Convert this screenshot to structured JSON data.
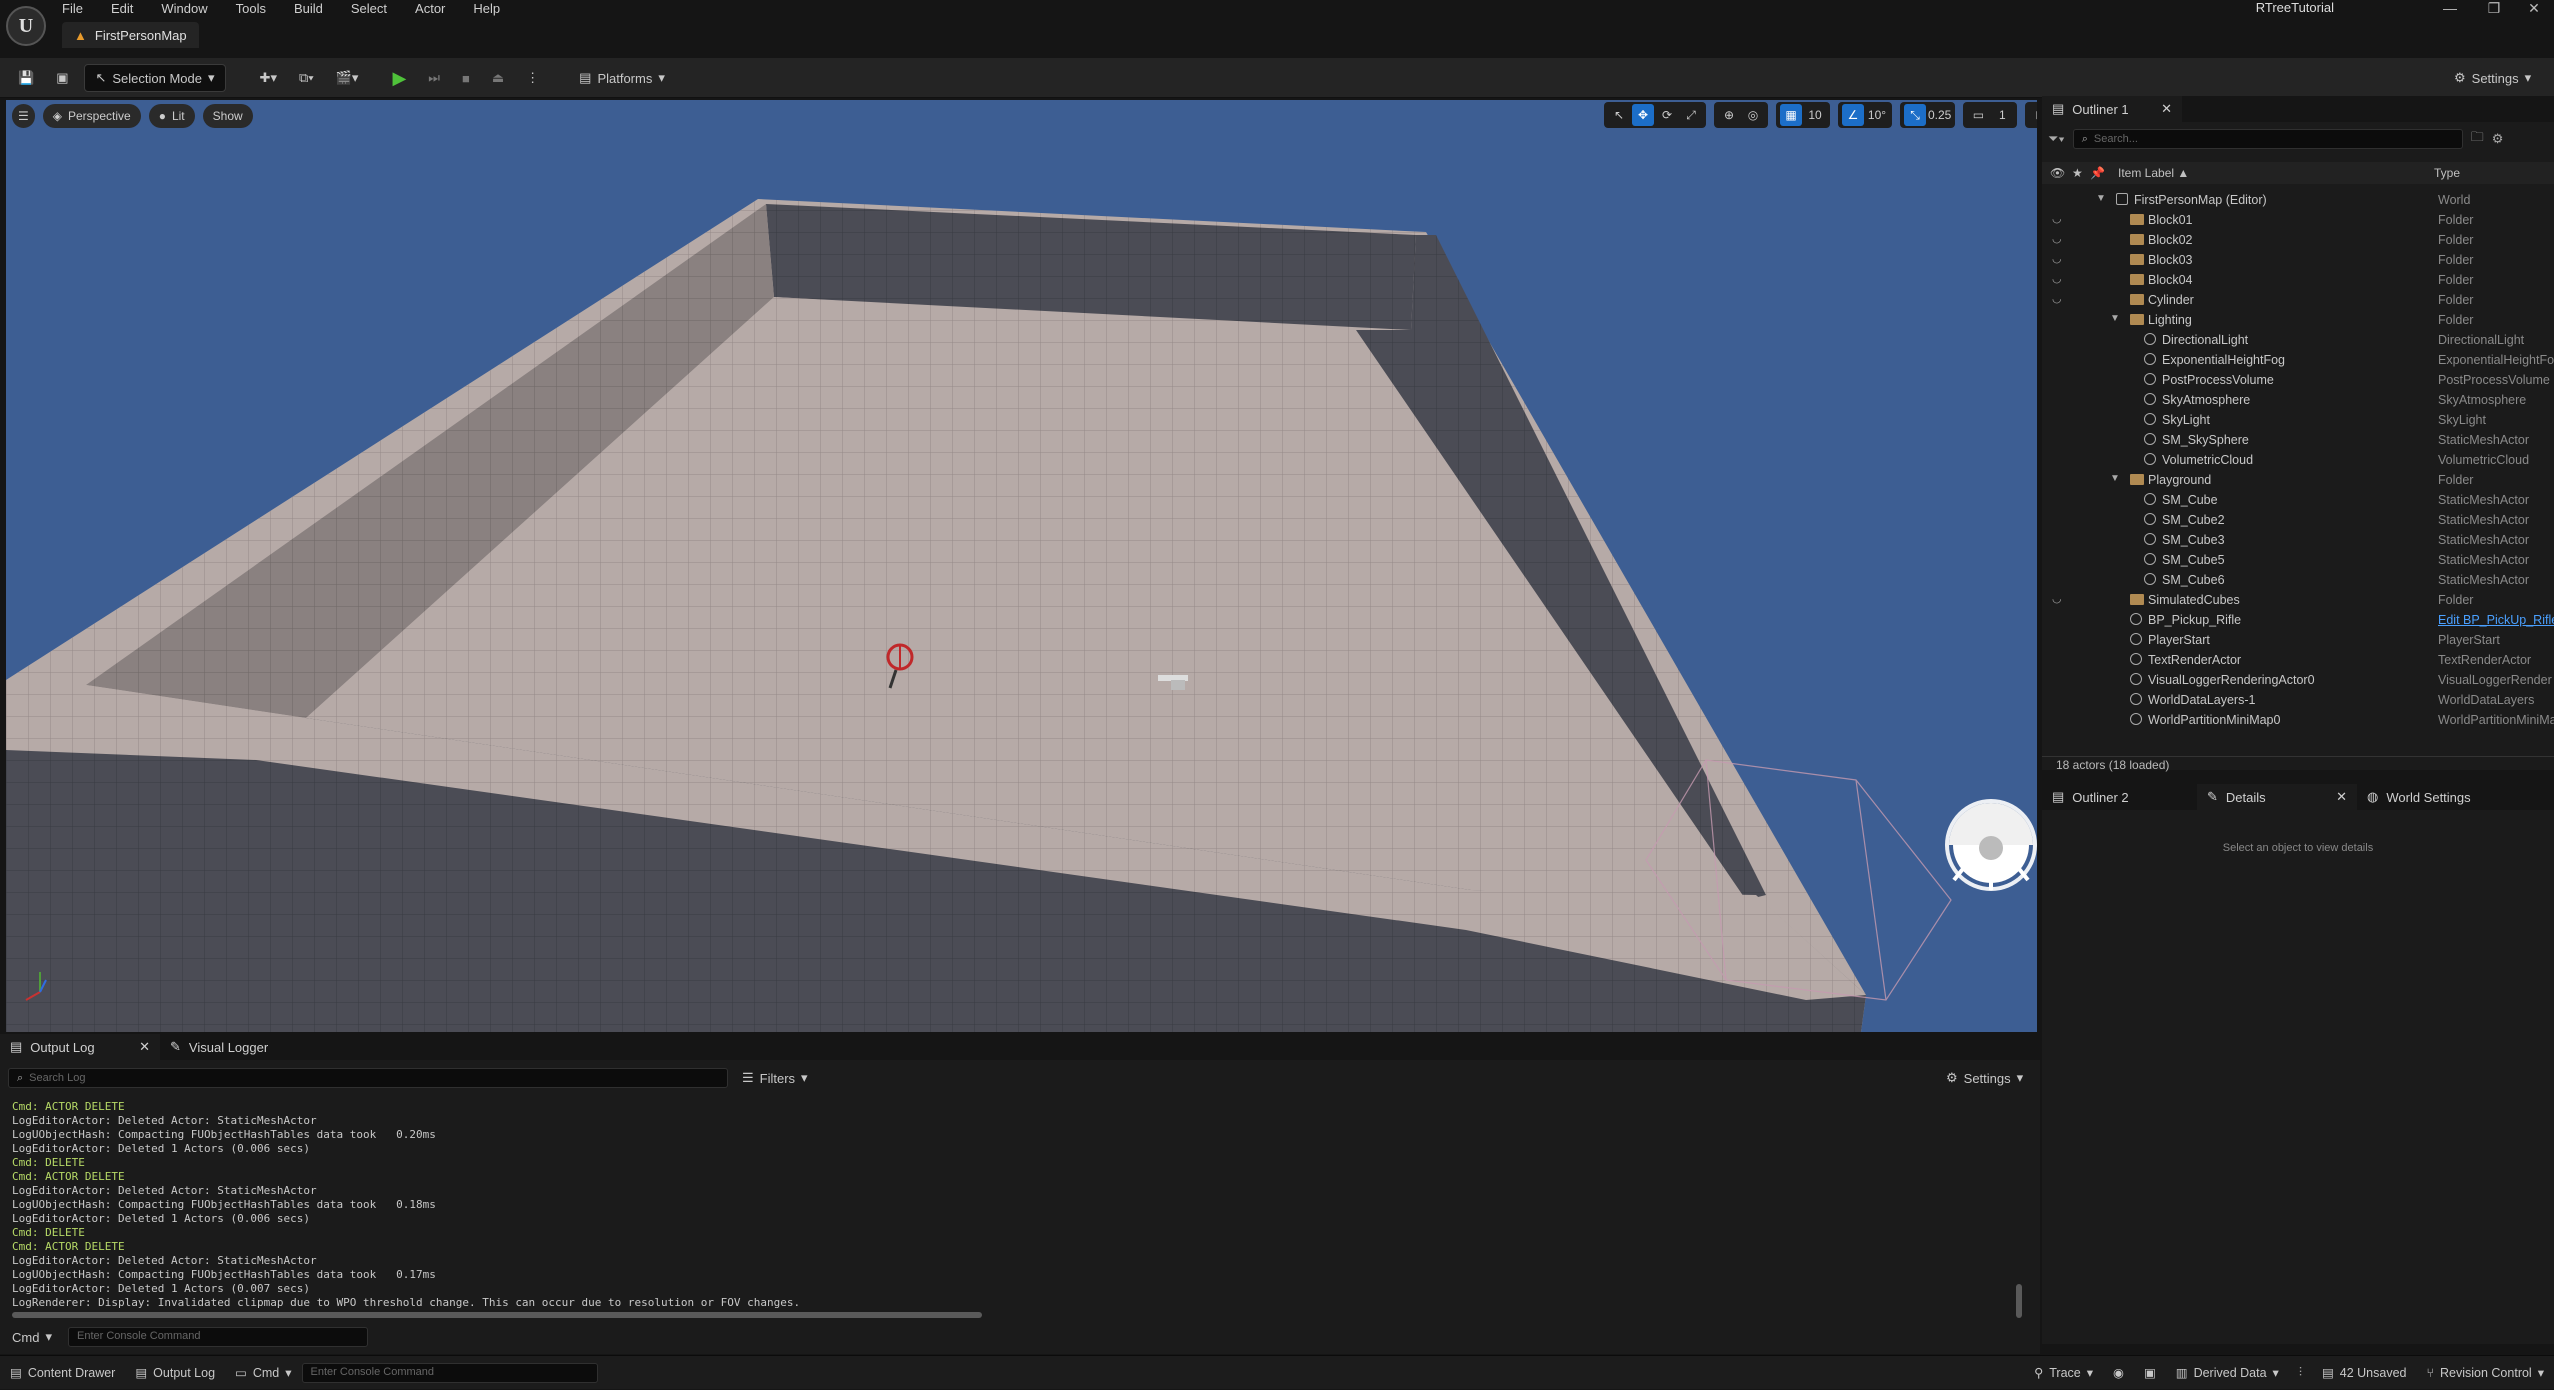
{
  "menu": [
    "File",
    "Edit",
    "Window",
    "Tools",
    "Build",
    "Select",
    "Actor",
    "Help"
  ],
  "map_tab": "FirstPersonMap",
  "app_title": "RTreeTutorial",
  "toolbar": {
    "selection_mode": "Selection Mode",
    "platforms": "Platforms",
    "settings": "Settings"
  },
  "viewport": {
    "perspective": "Perspective",
    "lit": "Lit",
    "show": "Show",
    "grid_snap": "10",
    "rot_snap": "10°",
    "scale_snap": "0.25",
    "camera_speed": "1"
  },
  "outliner": {
    "tab": "Outliner 1",
    "search_placeholder": "Search...",
    "col_label": "Item Label ▲",
    "col_type": "Type",
    "items": [
      {
        "label": "FirstPersonMap (Editor)",
        "type": "World",
        "indent": 0,
        "kind": "world",
        "caret": "▼"
      },
      {
        "label": "Block01",
        "type": "Folder",
        "indent": 1,
        "kind": "folder",
        "eye": "◡"
      },
      {
        "label": "Block02",
        "type": "Folder",
        "indent": 1,
        "kind": "folder",
        "eye": "◡"
      },
      {
        "label": "Block03",
        "type": "Folder",
        "indent": 1,
        "kind": "folder",
        "eye": "◡"
      },
      {
        "label": "Block04",
        "type": "Folder",
        "indent": 1,
        "kind": "folder",
        "eye": "◡"
      },
      {
        "label": "Cylinder",
        "type": "Folder",
        "indent": 1,
        "kind": "folder",
        "eye": "◡"
      },
      {
        "label": "Lighting",
        "type": "Folder",
        "indent": 1,
        "kind": "folder",
        "caret": "▼"
      },
      {
        "label": "DirectionalLight",
        "type": "DirectionalLight",
        "indent": 2,
        "kind": "actor"
      },
      {
        "label": "ExponentialHeightFog",
        "type": "ExponentialHeightFog",
        "indent": 2,
        "kind": "actor"
      },
      {
        "label": "PostProcessVolume",
        "type": "PostProcessVolume",
        "indent": 2,
        "kind": "actor"
      },
      {
        "label": "SkyAtmosphere",
        "type": "SkyAtmosphere",
        "indent": 2,
        "kind": "actor"
      },
      {
        "label": "SkyLight",
        "type": "SkyLight",
        "indent": 2,
        "kind": "actor"
      },
      {
        "label": "SM_SkySphere",
        "type": "StaticMeshActor",
        "indent": 2,
        "kind": "actor"
      },
      {
        "label": "VolumetricCloud",
        "type": "VolumetricCloud",
        "indent": 2,
        "kind": "actor"
      },
      {
        "label": "Playground",
        "type": "Folder",
        "indent": 1,
        "kind": "folder",
        "caret": "▼"
      },
      {
        "label": "SM_Cube",
        "type": "StaticMeshActor",
        "indent": 2,
        "kind": "actor"
      },
      {
        "label": "SM_Cube2",
        "type": "StaticMeshActor",
        "indent": 2,
        "kind": "actor"
      },
      {
        "label": "SM_Cube3",
        "type": "StaticMeshActor",
        "indent": 2,
        "kind": "actor"
      },
      {
        "label": "SM_Cube5",
        "type": "StaticMeshActor",
        "indent": 2,
        "kind": "actor"
      },
      {
        "label": "SM_Cube6",
        "type": "StaticMeshActor",
        "indent": 2,
        "kind": "actor"
      },
      {
        "label": "SimulatedCubes",
        "type": "Folder",
        "indent": 1,
        "kind": "folder",
        "eye": "◡"
      },
      {
        "label": "BP_Pickup_Rifle",
        "type": "Edit BP_PickUp_Rifle",
        "indent": 1,
        "kind": "actor",
        "link": true
      },
      {
        "label": "PlayerStart",
        "type": "PlayerStart",
        "indent": 1,
        "kind": "actor"
      },
      {
        "label": "TextRenderActor",
        "type": "TextRenderActor",
        "indent": 1,
        "kind": "actor"
      },
      {
        "label": "VisualLoggerRenderingActor0",
        "type": "VisualLoggerRender",
        "indent": 1,
        "kind": "actor"
      },
      {
        "label": "WorldDataLayers-1",
        "type": "WorldDataLayers",
        "indent": 1,
        "kind": "actor"
      },
      {
        "label": "WorldPartitionMiniMap0",
        "type": "WorldPartitionMiniMap",
        "indent": 1,
        "kind": "actor"
      }
    ],
    "count": "18 actors (18 loaded)"
  },
  "details": {
    "tabs": [
      "Outliner 2",
      "Details",
      "World Settings"
    ],
    "empty": "Select an object to view details"
  },
  "output_log": {
    "tabs": [
      "Output Log",
      "Visual Logger"
    ],
    "search_placeholder": "Search Log",
    "filters": "Filters",
    "settings": "Settings",
    "lines": [
      {
        "t": "Cmd: ACTOR DELETE",
        "c": "green"
      },
      {
        "t": "LogEditorActor: Deleted Actor: StaticMeshActor",
        "c": ""
      },
      {
        "t": "LogUObjectHash: Compacting FUObjectHashTables data took   0.20ms",
        "c": ""
      },
      {
        "t": "LogEditorActor: Deleted 1 Actors (0.006 secs)",
        "c": ""
      },
      {
        "t": "Cmd: DELETE",
        "c": "green"
      },
      {
        "t": "Cmd: ACTOR DELETE",
        "c": "green"
      },
      {
        "t": "LogEditorActor: Deleted Actor: StaticMeshActor",
        "c": ""
      },
      {
        "t": "LogUObjectHash: Compacting FUObjectHashTables data took   0.18ms",
        "c": ""
      },
      {
        "t": "LogEditorActor: Deleted 1 Actors (0.006 secs)",
        "c": ""
      },
      {
        "t": "Cmd: DELETE",
        "c": "green"
      },
      {
        "t": "Cmd: ACTOR DELETE",
        "c": "green"
      },
      {
        "t": "LogEditorActor: Deleted Actor: StaticMeshActor",
        "c": ""
      },
      {
        "t": "LogUObjectHash: Compacting FUObjectHashTables data took   0.17ms",
        "c": ""
      },
      {
        "t": "LogEditorActor: Deleted 1 Actors (0.007 secs)",
        "c": ""
      },
      {
        "t": "LogRenderer: Display: Invalidated clipmap due to WPO threshold change. This can occur due to resolution or FOV changes.",
        "c": ""
      }
    ],
    "cmd": "Cmd",
    "cmd_placeholder": "Enter Console Command"
  },
  "status": {
    "content_drawer": "Content Drawer",
    "output_log": "Output Log",
    "cmd": "Cmd",
    "cmd_placeholder": "Enter Console Command",
    "trace": "Trace",
    "derived_data": "Derived Data",
    "unsaved": "42 Unsaved",
    "revision_control": "Revision Control"
  }
}
